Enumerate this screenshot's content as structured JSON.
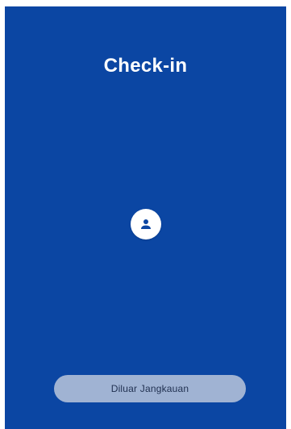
{
  "colors": {
    "background": "#0b46a3",
    "title_text": "#ffffff",
    "avatar_bg": "#ffffff",
    "avatar_icon": "#0b46a3",
    "status_button_bg": "#a0b3d3",
    "status_button_text": "#1f2f4f"
  },
  "header": {
    "title": "Check-in"
  },
  "center": {
    "icon": "person-icon"
  },
  "footer": {
    "status_button_label": "Diluar Jangkauan"
  }
}
